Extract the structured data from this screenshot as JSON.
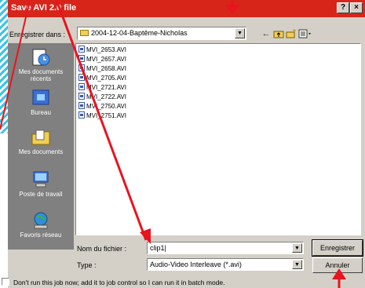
{
  "dialog": {
    "title": "Save AVI 2.0 file",
    "help_button": "?",
    "close_button": "×"
  },
  "toolbar": {
    "lookin_label": "Enregistrer dans :",
    "lookin_value": "2004-12-04-Baptême-Nicholas",
    "icons": [
      "back-icon",
      "up-folder-icon",
      "new-folder-icon",
      "view-menu-icon"
    ]
  },
  "places": [
    {
      "label": "Mes documents récents",
      "icon": "recent-documents-icon"
    },
    {
      "label": "Bureau",
      "icon": "desktop-icon"
    },
    {
      "label": "Mes documents",
      "icon": "my-documents-icon"
    },
    {
      "label": "Poste de travail",
      "icon": "my-computer-icon"
    },
    {
      "label": "Favoris réseau",
      "icon": "network-places-icon"
    }
  ],
  "files": [
    "MVI_2653.AVI",
    "MVI_2657.AVI",
    "MVI_2658.AVI",
    "MVI_2705.AVI",
    "MVI_2721.AVI",
    "MVI_2722.AVI",
    "MVI_2750.AVI",
    "MVI_2751.AVI"
  ],
  "filename": {
    "label": "Nom du fichier :",
    "value": "clip1|"
  },
  "filetype": {
    "label": "Type :",
    "value": "Audio-Video Interleave (*.avi)"
  },
  "buttons": {
    "save": "Enregistrer",
    "cancel": "Annuler"
  },
  "batch_checkbox": {
    "label": "Don't run this job now; add it to job control so I can run it in batch mode.",
    "checked": false
  },
  "colors": {
    "annotation_red": "#e8141e",
    "titlebar": "#d7251a",
    "background_stripes": "#3fc3e6"
  }
}
